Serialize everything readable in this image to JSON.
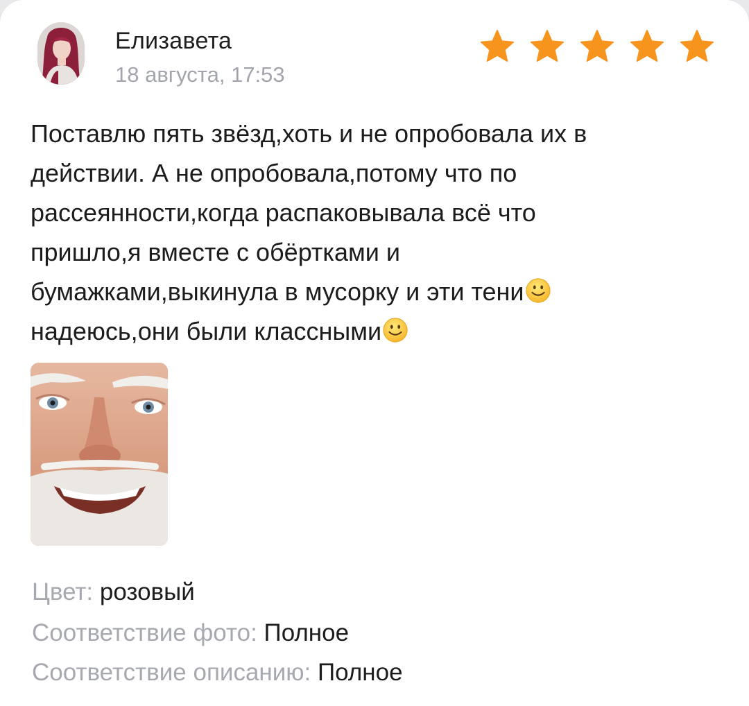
{
  "review": {
    "author": {
      "name": "Елизавета",
      "avatar_icon": "user-avatar-photo"
    },
    "date": "18 августа, 17:53",
    "rating": {
      "value": 5,
      "max": 5,
      "star_color": "#f7941d"
    },
    "text_lines": [
      "Поставлю пять звёзд,хоть и не опробовала их в",
      "действии. А не опробовала,потому что по",
      "рассеянности,когда распаковывала всё что",
      "пришло,я вместе с обёртками и",
      "бумажками,выкинула в мусорку и эти тени",
      "надеюсь,они были классными"
    ],
    "emoji": "slightly-smiling-face",
    "attachments": [
      {
        "type": "photo",
        "label": "review-photo"
      }
    ],
    "attributes": [
      {
        "key": "Цвет: ",
        "value": "розовый"
      },
      {
        "key": "Соответствие фото: ",
        "value": "Полное"
      },
      {
        "key": "Соответствие описанию: ",
        "value": "Полное"
      }
    ]
  },
  "colors": {
    "secondary_text": "#a3a5ad",
    "primary_text": "#1c1c1c",
    "background": "#ffffff"
  }
}
